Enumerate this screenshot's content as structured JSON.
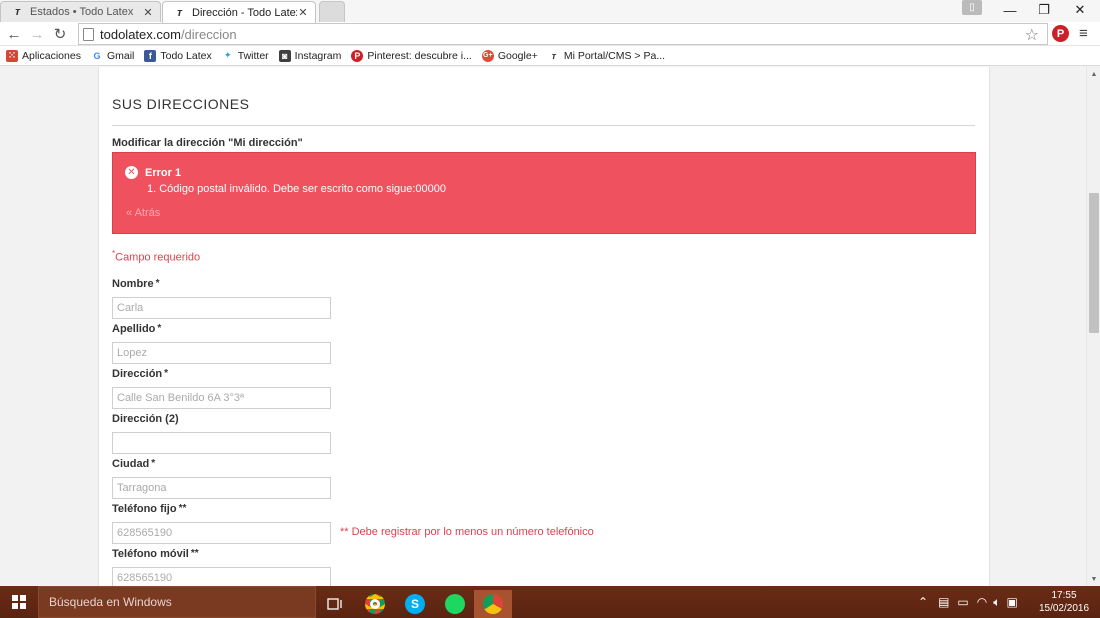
{
  "browser": {
    "tabs": [
      {
        "title": "Estados • Todo Latex",
        "active": false
      },
      {
        "title": "Dirección - Todo Latex",
        "active": true
      }
    ],
    "url_host": "todolatex.com",
    "url_path": "/direccion",
    "bookmarks": [
      {
        "label": "Aplicaciones",
        "icon": "apps-grid-icon",
        "color": "#d14836"
      },
      {
        "label": "Gmail",
        "icon": "google-g-icon",
        "color": "#4285f4"
      },
      {
        "label": "Todo Latex",
        "icon": "facebook-icon",
        "color": "#3b5998"
      },
      {
        "label": "Twitter",
        "icon": "twitter-bird-icon",
        "color": "#1da1f2"
      },
      {
        "label": "Instagram",
        "icon": "instagram-icon",
        "color": "#3f3f3f"
      },
      {
        "label": "Pinterest: descubre i...",
        "icon": "pinterest-icon",
        "color": "#cb2027"
      },
      {
        "label": "Google+",
        "icon": "google-plus-icon",
        "color": "#dd4b39"
      },
      {
        "label": "Mi Portal/CMS > Pa...",
        "icon": "todolatex-icon",
        "color": "#333333"
      }
    ]
  },
  "page": {
    "heading": "SUS DIRECCIONES",
    "subheading": "Modificar la dirección \"Mi dirección\"",
    "alert": {
      "title": "Error 1",
      "message": "1. Código postal inválido. Debe ser escrito como sigue:00000",
      "back_link": "« Atrás",
      "color": "#f0515f"
    },
    "required_note": "Campo requerido",
    "required_mark": "*",
    "fields": [
      {
        "label": "Nombre",
        "mark": "*",
        "placeholder": "Carla"
      },
      {
        "label": "Apellido",
        "mark": "*",
        "placeholder": "Lopez"
      },
      {
        "label": "Dirección",
        "mark": "*",
        "placeholder": "Calle San Benildo 6A 3°3ª"
      },
      {
        "label": "Dirección (2)",
        "mark": "",
        "placeholder": ""
      },
      {
        "label": "Ciudad",
        "mark": "*",
        "placeholder": "Tarragona"
      },
      {
        "label": "Teléfono fijo",
        "mark": "**",
        "placeholder": "628565190"
      },
      {
        "label": "Teléfono móvil",
        "mark": "**",
        "placeholder": "628565190"
      }
    ],
    "phone_note": "** Debe registrar por lo menos un número telefónico"
  },
  "taskbar": {
    "search_placeholder": "Búsqueda en Windows",
    "time": "17:55",
    "date": "15/02/2016",
    "accent": "#6b2b14"
  }
}
